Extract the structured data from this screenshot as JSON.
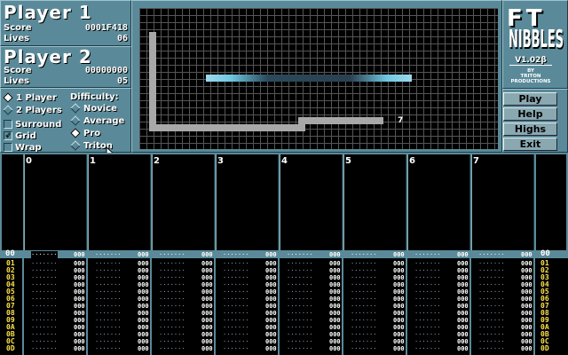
{
  "player1": {
    "title": "Player 1",
    "score_label": "Score",
    "score": "0001F418",
    "lives_label": "Lives",
    "lives": "06"
  },
  "player2": {
    "title": "Player 2",
    "score_label": "Score",
    "score": "00000000",
    "lives_label": "Lives",
    "lives": "05"
  },
  "options": {
    "one_player": "1 Player",
    "two_players": "2 Players",
    "difficulty_label": "Difficulty:",
    "novice": "Novice",
    "average": "Average",
    "pro": "Pro",
    "triton": "Triton",
    "surround": "Surround",
    "grid": "Grid",
    "wrap": "Wrap",
    "selected_players": "1 Player",
    "selected_difficulty": "Pro",
    "grid_checked": true,
    "surround_checked": false,
    "wrap_checked": false
  },
  "game": {
    "food_number": "7"
  },
  "logo": {
    "ft": "FT",
    "nibbles": "NIBBLES",
    "version": "V1.02β",
    "by": "BY",
    "author1": "TRITON",
    "author2": "PRODUCTIONS"
  },
  "buttons": {
    "play": "Play",
    "help": "Help",
    "highs": "Highs",
    "exit": "Exit"
  },
  "tracker": {
    "channels": [
      "0",
      "1",
      "2",
      "3",
      "4",
      "5",
      "6",
      "7"
    ],
    "current_row": "00",
    "rows": [
      "01",
      "02",
      "03",
      "04",
      "05",
      "06",
      "07",
      "08",
      "09",
      "0A",
      "0B",
      "0C",
      "0D"
    ],
    "empty_note": "·······",
    "empty_value": "000"
  },
  "colors": {
    "panel": "#5a8a99",
    "snake_p1": "#a8a8a8",
    "snake_p2": "#6fc7e0",
    "row_number": "#ffe34a"
  }
}
